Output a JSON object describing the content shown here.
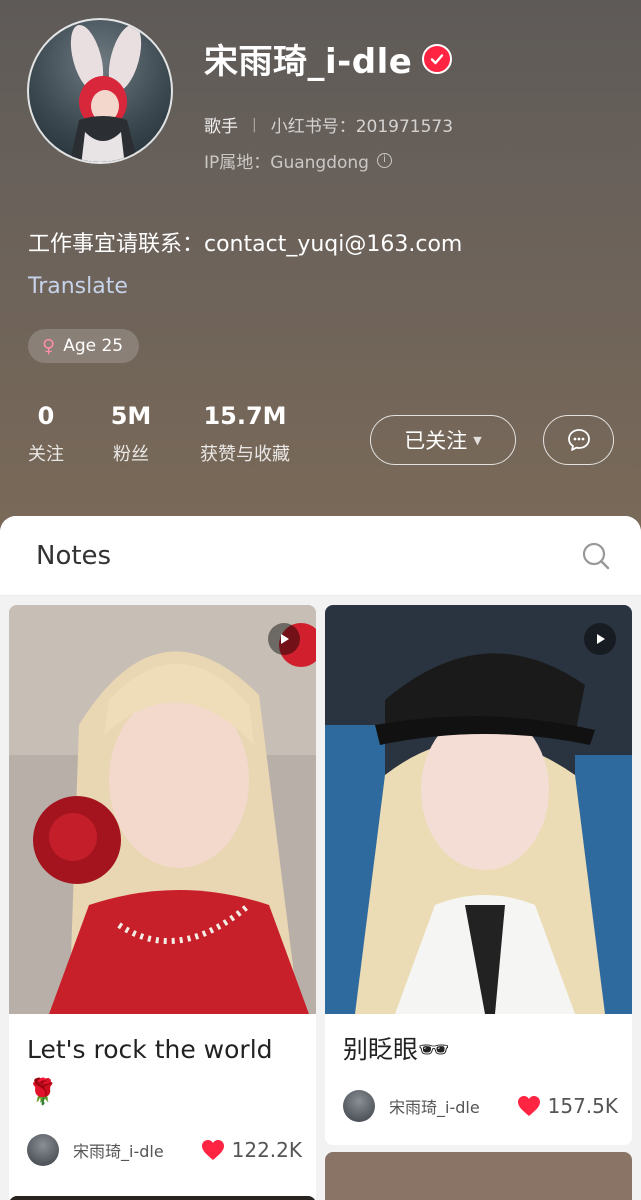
{
  "profile": {
    "name": "宋雨琦_i-dle",
    "occupation": "歌手",
    "xhs_id": "小红书号：201971573",
    "ip_location": "IP属地：Guangdong",
    "bio": "工作事宜请联系：contact_yuqi@163.com",
    "translate_label": "Translate",
    "tag_age": "Age 25"
  },
  "stats": [
    {
      "value": "0",
      "label": "关注"
    },
    {
      "value": "5M",
      "label": "粉丝"
    },
    {
      "value": "15.7M",
      "label": "获赞与收藏"
    }
  ],
  "actions": {
    "follow_label": "已关注",
    "message_icon": "chat-bubble-icon"
  },
  "notes": {
    "section_title": "Notes",
    "search_icon": "search-icon",
    "cards": [
      {
        "title_line1": "Let's rock the world",
        "title_line2": "🌹",
        "author": "宋雨琦_i-dle",
        "likes": "122.2K",
        "is_video": true
      },
      {
        "title_line1": "别眨眼🕶",
        "author": "宋雨琦_i-dle",
        "likes": "157.5K",
        "is_video": true
      }
    ]
  },
  "colors": {
    "accent_red": "#ff2442",
    "header_top": "#5e5a58",
    "header_bottom": "#7b6a58"
  }
}
